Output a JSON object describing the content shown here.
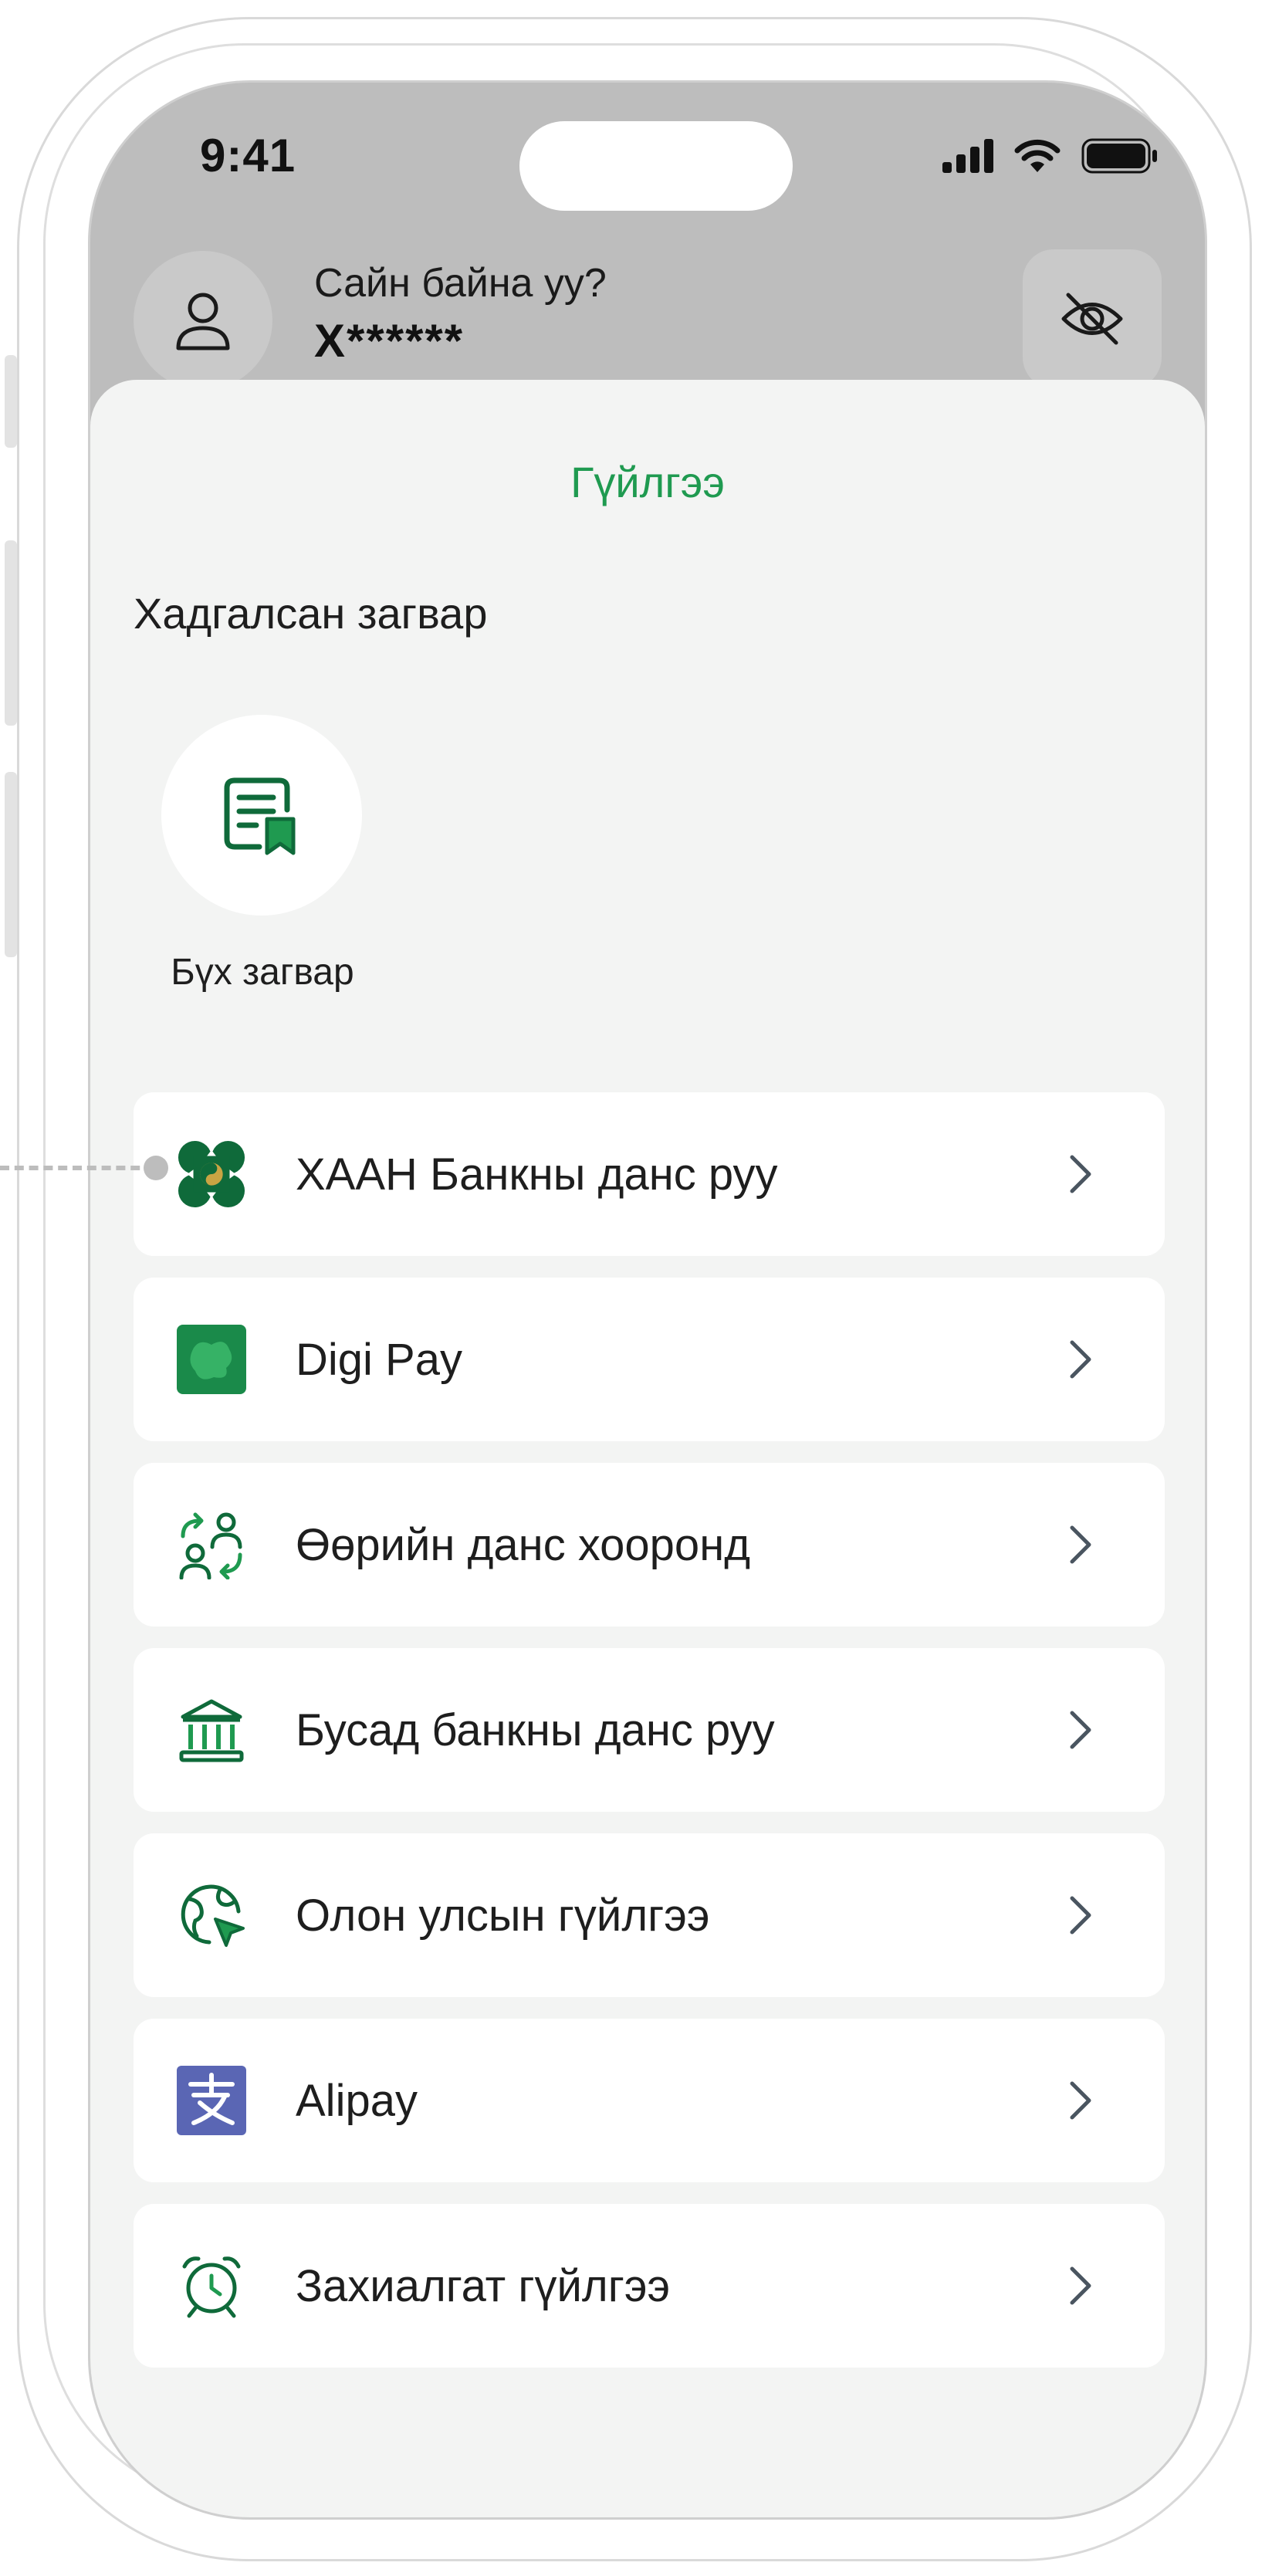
{
  "status_bar": {
    "time": "9:41"
  },
  "header": {
    "greeting": "Сайн байна уу?",
    "masked_name": "Х******"
  },
  "sheet": {
    "title": "Гүйлгээ",
    "saved_templates_label": "Хадгалсан загвар",
    "all_templates_label": "Бүх загвар"
  },
  "menu": [
    {
      "label": "ХААН Банкны данс руу",
      "icon": "khan-bank-logo-icon"
    },
    {
      "label": "Digi Pay",
      "icon": "digipay-logo-icon"
    },
    {
      "label": "Өөрийн данс хооронд",
      "icon": "transfer-between-own-accounts-icon"
    },
    {
      "label": "Бусад банкны данс руу",
      "icon": "bank-building-icon"
    },
    {
      "label": "Олон улсын гүйлгээ",
      "icon": "globe-send-icon"
    },
    {
      "label": "Alipay",
      "icon": "alipay-logo-icon"
    },
    {
      "label": "Захиалгат гүйлгээ",
      "icon": "alarm-clock-icon"
    }
  ],
  "colors": {
    "brand_green": "#1f9a50",
    "dark_green": "#0f6a3a",
    "alipay_blue": "#5a66b4",
    "sheet_bg": "#f3f4f3",
    "header_bg": "#bdbdbd"
  }
}
